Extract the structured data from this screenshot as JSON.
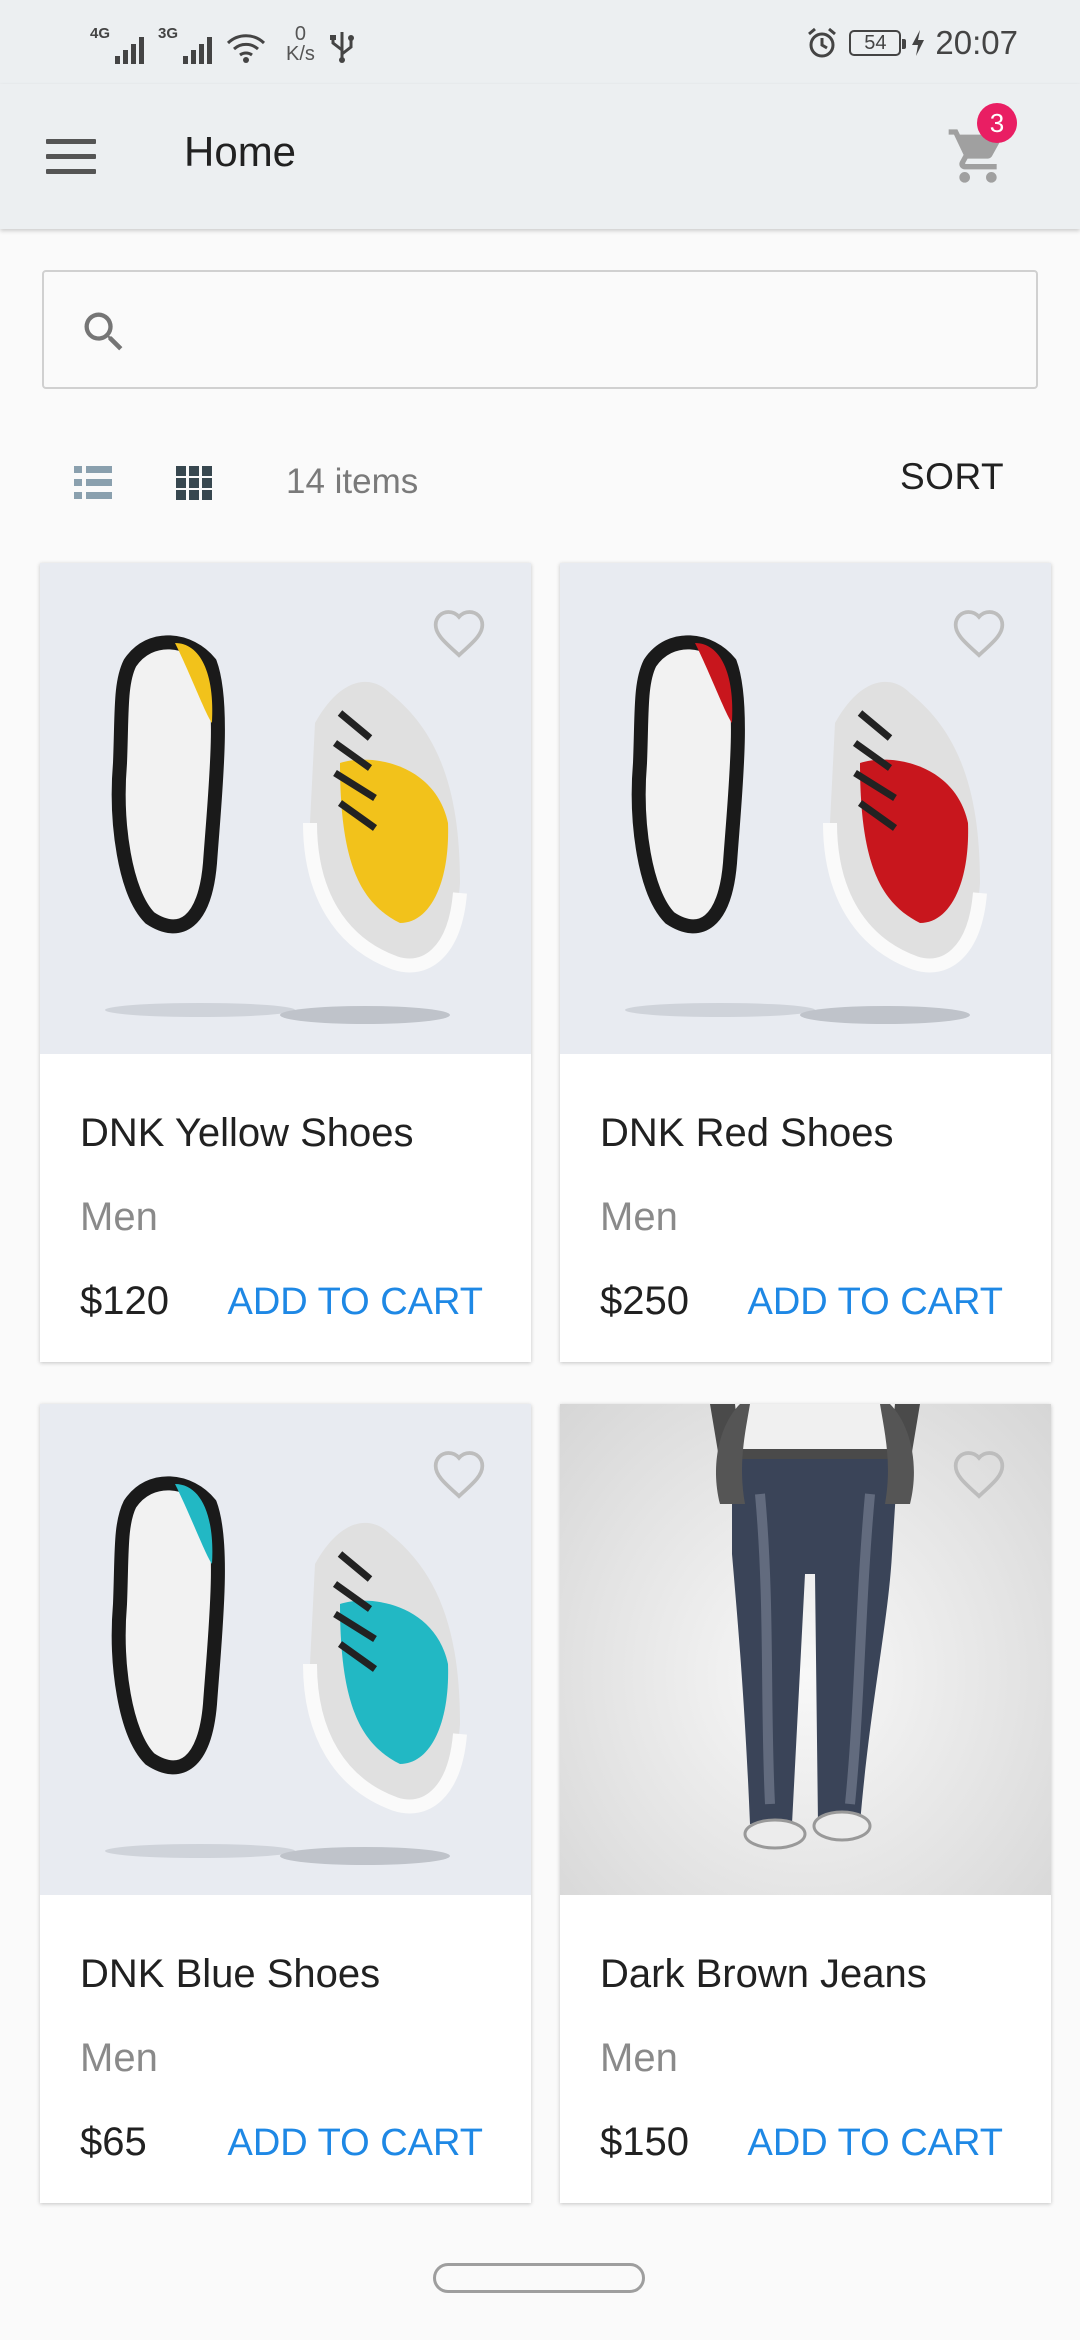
{
  "status_bar": {
    "network_1": "4G",
    "network_2": "3G",
    "speed_value": "0",
    "speed_unit": "K/s",
    "battery": "54",
    "time": "20:07"
  },
  "app_bar": {
    "title": "Home",
    "cart_badge": "3"
  },
  "search": {
    "value": "",
    "placeholder": ""
  },
  "toolbar": {
    "item_count": "14 items",
    "sort_label": "SORT"
  },
  "products": [
    {
      "name": "DNK Yellow Shoes",
      "category": "Men",
      "price": "$120",
      "action": "ADD TO CART",
      "accent": "#f2c21b"
    },
    {
      "name": "DNK Red Shoes",
      "category": "Men",
      "price": "$250",
      "action": "ADD TO CART",
      "accent": "#c8161d"
    },
    {
      "name": "DNK Blue Shoes",
      "category": "Men",
      "price": "$65",
      "action": "ADD TO CART",
      "accent": "#22b8c4"
    },
    {
      "name": "Dark Brown Jeans",
      "category": "Men",
      "price": "$150",
      "action": "ADD TO CART",
      "accent": "#3a4458"
    }
  ],
  "colors": {
    "accent": "#1e88e5",
    "badge": "#e91e63",
    "appbar": "#eceff1"
  }
}
